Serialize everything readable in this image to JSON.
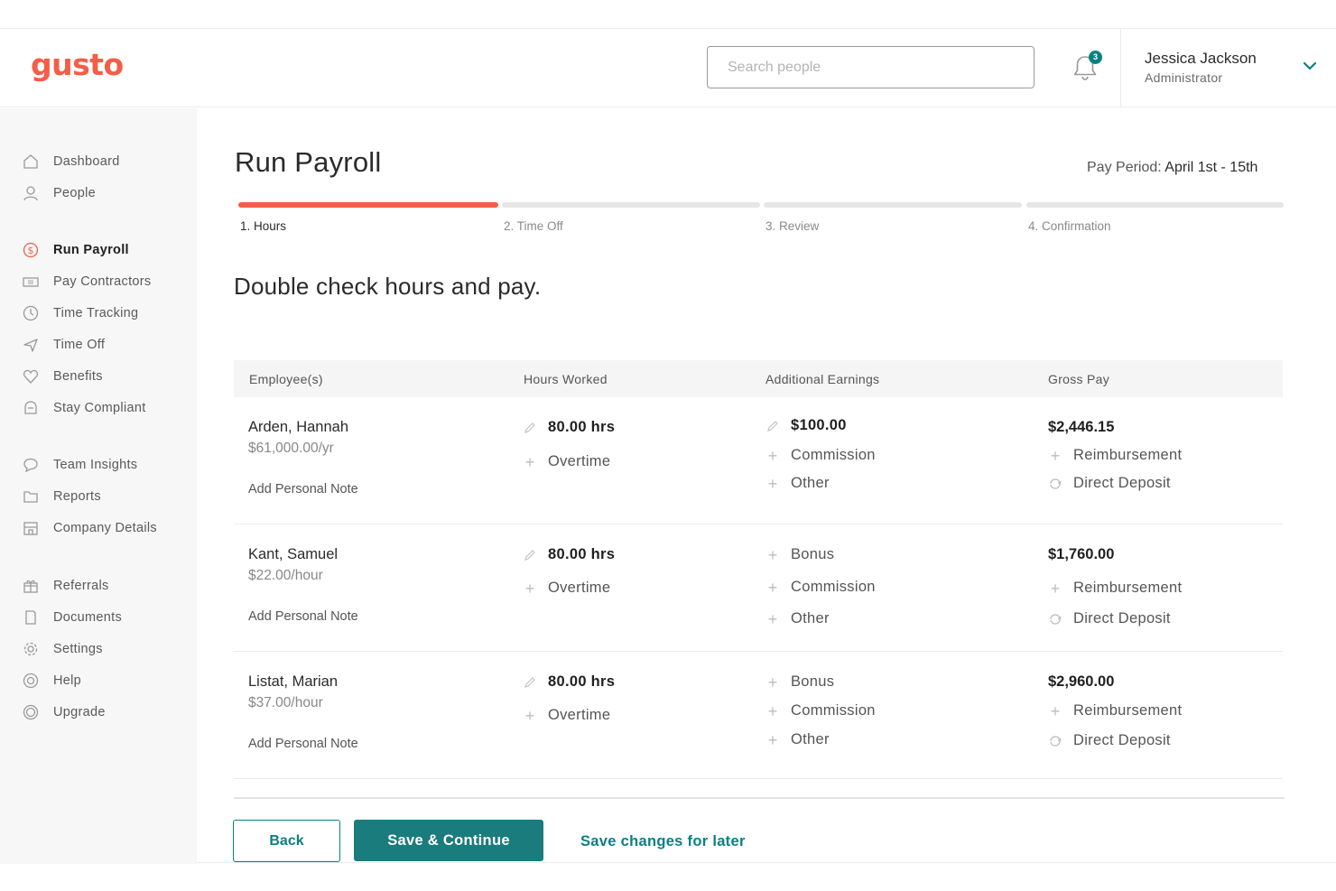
{
  "header": {
    "logo": "gusto",
    "search_placeholder": "Search people",
    "notification_count": "3",
    "user": {
      "name": "Jessica Jackson",
      "role": "Administrator"
    }
  },
  "sidebar": {
    "items": [
      {
        "label": "Dashboard",
        "icon": "home-icon"
      },
      {
        "label": "People",
        "icon": "person-icon"
      },
      {
        "label": "Run Payroll",
        "icon": "dollar-circle-icon",
        "active": true
      },
      {
        "label": "Pay Contractors",
        "icon": "money-icon"
      },
      {
        "label": "Time Tracking",
        "icon": "clock-icon"
      },
      {
        "label": "Time Off",
        "icon": "plane-icon"
      },
      {
        "label": "Benefits",
        "icon": "heart-icon"
      },
      {
        "label": "Stay Compliant",
        "icon": "compliance-icon"
      },
      {
        "label": "Team Insights",
        "icon": "chat-bubble-icon"
      },
      {
        "label": "Reports",
        "icon": "folder-icon"
      },
      {
        "label": "Company Details",
        "icon": "building-icon"
      },
      {
        "label": "Referrals",
        "icon": "gift-icon"
      },
      {
        "label": "Documents",
        "icon": "document-icon"
      },
      {
        "label": "Settings",
        "icon": "gear-icon"
      },
      {
        "label": "Help",
        "icon": "lifebuoy-icon"
      },
      {
        "label": "Upgrade",
        "icon": "upgrade-icon"
      }
    ]
  },
  "main": {
    "title": "Run Payroll",
    "pay_period_label": "Pay Period:",
    "pay_period_value": "April 1st - 15th",
    "steps": [
      {
        "label": "1. Hours",
        "active": true
      },
      {
        "label": "2. Time Off",
        "active": false
      },
      {
        "label": "3. Review",
        "active": false
      },
      {
        "label": "4. Confirmation",
        "active": false
      }
    ],
    "subtitle": "Double check hours and pay.",
    "table": {
      "headers": [
        "Employee(s)",
        "Hours Worked",
        "Additional Earnings",
        "Gross Pay"
      ],
      "add_note_label": "Add Personal Note",
      "overtime_label": "Overtime",
      "reimbursement_label": "Reimbursement",
      "direct_deposit_label": "Direct Deposit",
      "rows": [
        {
          "name": "Arden, Hannah",
          "rate": "$61,000.00/yr",
          "hours": "80.00 hrs",
          "earnings": [
            {
              "label": "$100.00",
              "icon": "pencil-icon",
              "strong": true
            },
            {
              "label": "Commission",
              "icon": "plus-icon"
            },
            {
              "label": "Other",
              "icon": "plus-icon"
            }
          ],
          "gross": "$2,446.15"
        },
        {
          "name": "Kant, Samuel",
          "rate": "$22.00/hour",
          "hours": "80.00 hrs",
          "earnings": [
            {
              "label": "Bonus",
              "icon": "plus-icon"
            },
            {
              "label": "Commission",
              "icon": "plus-icon"
            },
            {
              "label": "Other",
              "icon": "plus-icon"
            }
          ],
          "gross": "$1,760.00"
        },
        {
          "name": "Listat, Marian",
          "rate": "$37.00/hour",
          "hours": "80.00 hrs",
          "earnings": [
            {
              "label": "Bonus",
              "icon": "plus-icon"
            },
            {
              "label": "Commission",
              "icon": "plus-icon"
            },
            {
              "label": "Other",
              "icon": "plus-icon"
            }
          ],
          "gross": "$2,960.00"
        }
      ]
    },
    "actions": {
      "back": "Back",
      "save_continue": "Save & Continue",
      "save_later": "Save changes for later"
    }
  },
  "colors": {
    "brand": "#f45d48",
    "accent": "#0a8080",
    "primary_button": "#1a7c7c"
  }
}
